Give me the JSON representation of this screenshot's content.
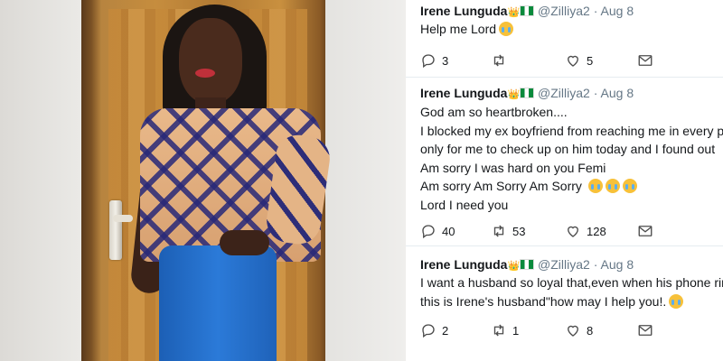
{
  "tweets": [
    {
      "name": "Irene Lunguda",
      "handle": "@Zilliya2",
      "date": "Aug 8",
      "lines": [
        "Help me Lord"
      ],
      "replies": "3",
      "retweets": "",
      "likes": "5"
    },
    {
      "name": "Irene Lunguda",
      "handle": "@Zilliya2",
      "date": "Aug 8",
      "lines": [
        "God am so heartbroken....",
        "I blocked my ex boyfriend from reaching me in every p",
        "only for me to check up on him today and I found out",
        "Am sorry I was hard on you Femi",
        "Am sorry Am Sorry Am Sorry",
        "Lord I need you"
      ],
      "replies": "40",
      "retweets": "53",
      "likes": "128"
    },
    {
      "name": "Irene Lunguda",
      "handle": "@Zilliya2",
      "date": "Aug 8",
      "lines": [
        "I want a husband so loyal that,even when his phone rin",
        "this is Irene's husband\"how may I help you!."
      ],
      "replies": "2",
      "retweets": "1",
      "likes": "8"
    }
  ],
  "separator": "·",
  "icons": {
    "reply": "reply-icon",
    "retweet": "retweet-icon",
    "like": "heart-icon",
    "dm": "envelope-icon",
    "crown": "crown-emoji-icon",
    "flag": "nigeria-flag-icon",
    "crying": "crying-face-emoji-icon",
    "laughing": "tears-of-joy-emoji-icon"
  },
  "colors": {
    "text": "#14171a",
    "muted": "#657786",
    "divider": "#e6ecf0"
  }
}
